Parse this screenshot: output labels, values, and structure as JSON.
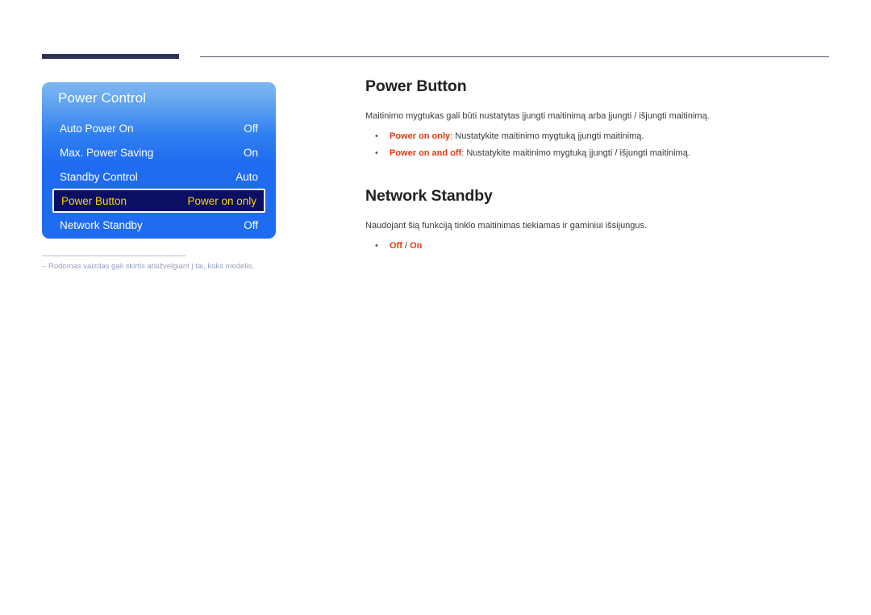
{
  "osd": {
    "title": "Power Control",
    "items": [
      {
        "label": "Auto Power On",
        "value": "Off",
        "selected": false
      },
      {
        "label": "Max. Power Saving",
        "value": "On",
        "selected": false
      },
      {
        "label": "Standby Control",
        "value": "Auto",
        "selected": false
      },
      {
        "label": "Power Button",
        "value": "Power on only",
        "selected": true
      },
      {
        "label": "Network Standby",
        "value": "Off",
        "selected": false
      }
    ]
  },
  "footnote": {
    "dash": "–",
    "text": "Rodomas vaizdas gali skirtis atsižvelgiant į tai, koks modelis."
  },
  "sections": [
    {
      "title": "Power Button",
      "body": "Maitinimo mygtukas gali būti nustatytas įjungti maitinimą arba įjungti / išjungti maitinimą.",
      "bullets": [
        {
          "bullet": "•",
          "term": "Power on only",
          "rest": ": Nustatykite maitinimo mygtuką įjungti maitinimą."
        },
        {
          "bullet": "•",
          "term": "Power on and off",
          "rest": ": Nustatykite maitinimo mygtuką įjungti / išjungti maitinimą."
        }
      ]
    },
    {
      "title": "Network Standby",
      "body": "Naudojant šią funkciją tinklo maitinimas tiekiamas ir gaminiui išsijungus.",
      "bullets": [
        {
          "bullet": "•",
          "term": "Off",
          "sep": " / ",
          "term2": "On",
          "rest": ""
        }
      ]
    }
  ],
  "colors": {
    "accent_red": "#e8380d",
    "osd_blue": "#1f6cf0",
    "osd_selected_bg": "#0a0f63",
    "osd_selected_text": "#ffd400",
    "rule_navy": "#2e3253"
  }
}
